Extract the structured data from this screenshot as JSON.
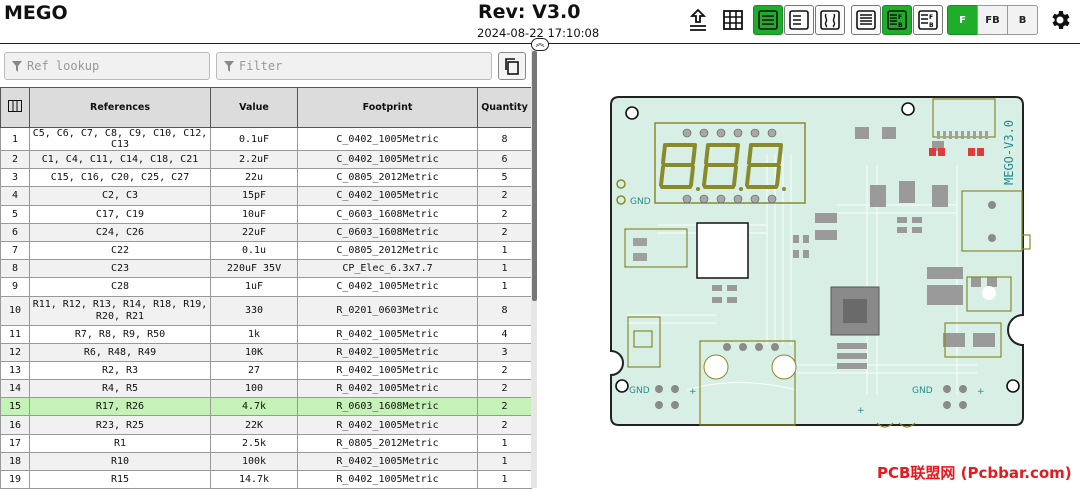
{
  "header": {
    "app_title": "MEGO",
    "revision": "Rev: V3.0",
    "date": "2024-08-22 17:10:08"
  },
  "toolbar": {
    "icons": [
      "upload-pcb-icon",
      "grid-icon",
      "bom-only-icon",
      "bom-left-drawings-right-icon",
      "bom-top-drawings-bottom-icon",
      "bom-list-icon",
      "bom-grouped-fb-icon",
      "bom-split-fb-icon"
    ],
    "active_layout": "bom-only",
    "active_group": "bom-grouped-fb",
    "layers": [
      "F",
      "FB",
      "B"
    ],
    "active_layer": "F",
    "accent_color": "#1fae2a"
  },
  "search": {
    "ref_lookup_placeholder": "Ref lookup",
    "filter_placeholder": "Filter"
  },
  "bom": {
    "columns": [
      "References",
      "Value",
      "Footprint",
      "Quantity"
    ],
    "rows": [
      {
        "n": "1",
        "refs": "C5, C6, C7, C8, C9, C10, C12, C13",
        "value": "0.1uF",
        "footprint": "C_0402_1005Metric",
        "qty": "8"
      },
      {
        "n": "2",
        "refs": "C1, C4, C11, C14, C18, C21",
        "value": "2.2uF",
        "footprint": "C_0402_1005Metric",
        "qty": "6"
      },
      {
        "n": "3",
        "refs": "C15, C16, C20, C25, C27",
        "value": "22u",
        "footprint": "C_0805_2012Metric",
        "qty": "5"
      },
      {
        "n": "4",
        "refs": "C2, C3",
        "value": "15pF",
        "footprint": "C_0402_1005Metric",
        "qty": "2"
      },
      {
        "n": "5",
        "refs": "C17, C19",
        "value": "10uF",
        "footprint": "C_0603_1608Metric",
        "qty": "2"
      },
      {
        "n": "6",
        "refs": "C24, C26",
        "value": "22uF",
        "footprint": "C_0603_1608Metric",
        "qty": "2"
      },
      {
        "n": "7",
        "refs": "C22",
        "value": "0.1u",
        "footprint": "C_0805_2012Metric",
        "qty": "1"
      },
      {
        "n": "8",
        "refs": "C23",
        "value": "220uF 35V",
        "footprint": "CP_Elec_6.3x7.7",
        "qty": "1"
      },
      {
        "n": "9",
        "refs": "C28",
        "value": "1uF",
        "footprint": "C_0402_1005Metric",
        "qty": "1"
      },
      {
        "n": "10",
        "refs": "R11, R12, R13, R14, R18, R19, R20, R21",
        "value": "330",
        "footprint": "R_0201_0603Metric",
        "qty": "8"
      },
      {
        "n": "11",
        "refs": "R7, R8, R9, R50",
        "value": "1k",
        "footprint": "R_0402_1005Metric",
        "qty": "4"
      },
      {
        "n": "12",
        "refs": "R6, R48, R49",
        "value": "10K",
        "footprint": "R_0402_1005Metric",
        "qty": "3"
      },
      {
        "n": "13",
        "refs": "R2, R3",
        "value": "27",
        "footprint": "R_0402_1005Metric",
        "qty": "2"
      },
      {
        "n": "14",
        "refs": "R4, R5",
        "value": "100",
        "footprint": "R_0402_1005Metric",
        "qty": "2"
      },
      {
        "n": "15",
        "refs": "R17, R26",
        "value": "4.7k",
        "footprint": "R_0603_1608Metric",
        "qty": "2"
      },
      {
        "n": "16",
        "refs": "R23, R25",
        "value": "22K",
        "footprint": "R_0402_1005Metric",
        "qty": "2"
      },
      {
        "n": "17",
        "refs": "R1",
        "value": "2.5k",
        "footprint": "R_0805_2012Metric",
        "qty": "1"
      },
      {
        "n": "18",
        "refs": "R10",
        "value": "100k",
        "footprint": "R_0402_1005Metric",
        "qty": "1"
      },
      {
        "n": "19",
        "refs": "R15",
        "value": "14.7k",
        "footprint": "R_0402_1005Metric",
        "qty": "1"
      }
    ],
    "highlighted_row": "15",
    "highlight_color": "#c5f2b6"
  },
  "pcb": {
    "board_label": "MEGO-V3.0",
    "gnd_label_left_top": "GND",
    "gnd_label_bottom_left": "GND",
    "gnd_label_bottom_right": "GND",
    "plus_labels": [
      "+",
      "+",
      "+"
    ],
    "board_color": "#d8efe6",
    "silk_color": "#8a8a2a",
    "pad_color": "#a0a0a0"
  },
  "watermark": "PCB联盟网 (Pcbbar.com)"
}
